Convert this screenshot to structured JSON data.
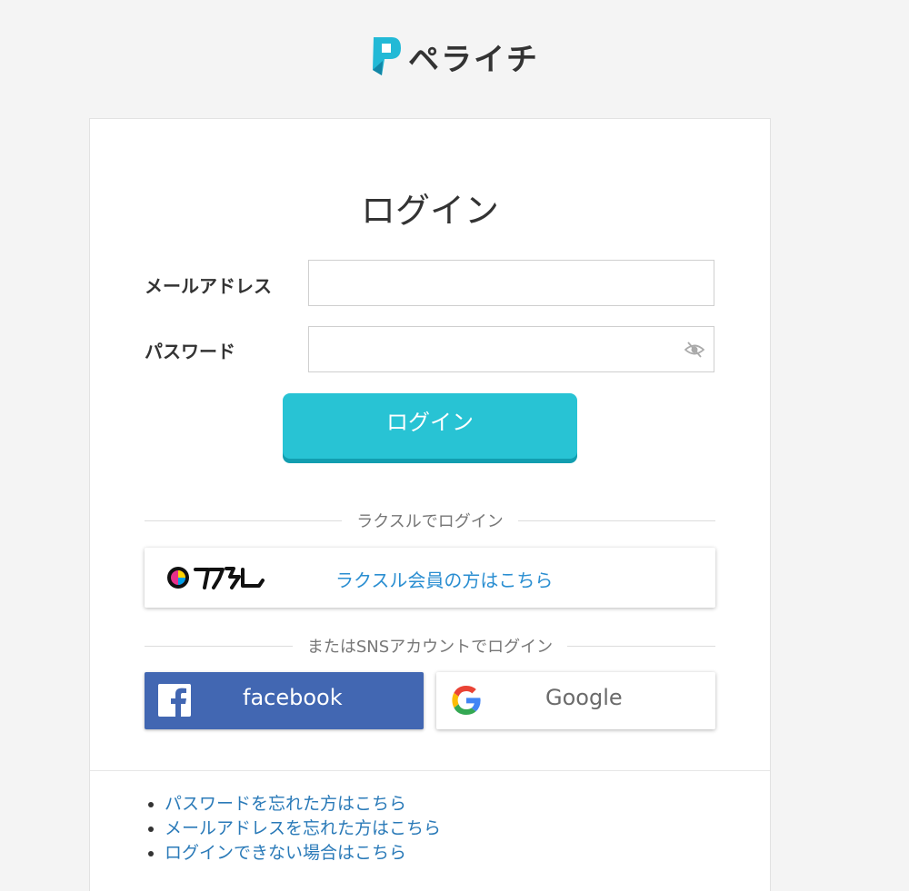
{
  "header": {
    "brand": "ペライチ"
  },
  "login": {
    "title": "ログイン",
    "email_label": "メールアドレス",
    "email_value": "",
    "password_label": "パスワード",
    "password_value": "",
    "submit_label": "ログイン"
  },
  "raksul": {
    "divider": "ラクスルでログイン",
    "button_label": "ラクスル会員の方はこちら"
  },
  "sns": {
    "divider": "またはSNSアカウントでログイン",
    "facebook_label": "facebook",
    "google_label": "Google"
  },
  "help_links": [
    "パスワードを忘れた方はこちら",
    "メールアドレスを忘れた方はこちら",
    "ログインできない場合はこちら"
  ],
  "colors": {
    "accent": "#28c3d4",
    "facebook": "#4267b2",
    "link": "#2a7ab8",
    "background": "#f4f4f4"
  },
  "icons": {
    "brand": "peraichi-logo-icon",
    "password_toggle": "eye-slash-icon",
    "raksul": "raksul-logo",
    "facebook": "facebook-icon",
    "google": "google-icon"
  }
}
